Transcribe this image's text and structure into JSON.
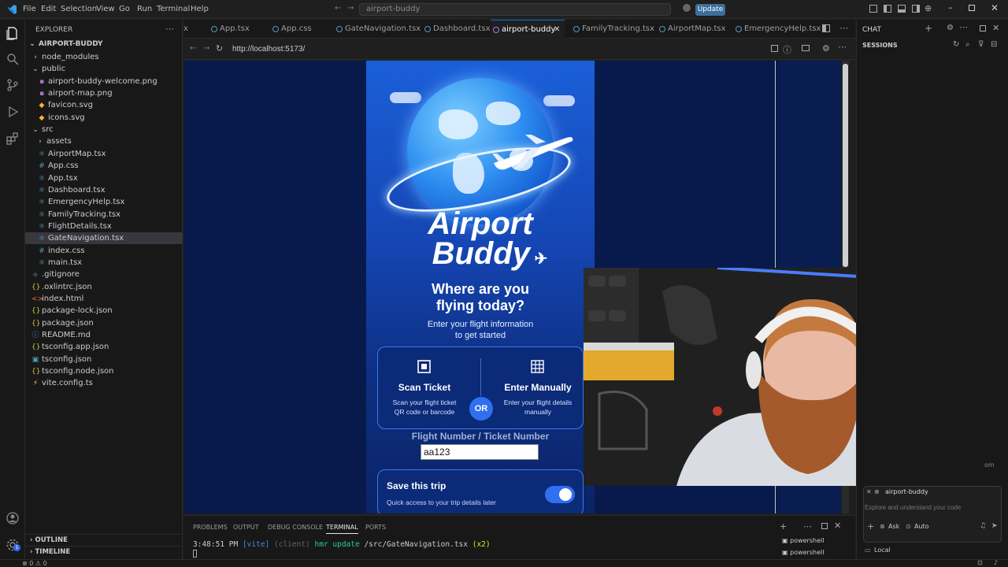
{
  "titlebar": {
    "menus": [
      "File",
      "Edit",
      "Selection",
      "View",
      "Go",
      "Run",
      "Terminal",
      "Help"
    ],
    "search_text": "airport-buddy",
    "update_label": "Update"
  },
  "explorer": {
    "header": "EXPLORER",
    "project": "AIRPORT-BUDDY",
    "items": [
      {
        "label": "node_modules",
        "kind": "folder-closed"
      },
      {
        "label": "public",
        "kind": "folder-open"
      },
      {
        "label": "airport-buddy-welcome.png",
        "kind": "image"
      },
      {
        "label": "airport-map.png",
        "kind": "image"
      },
      {
        "label": "favicon.svg",
        "kind": "svg"
      },
      {
        "label": "icons.svg",
        "kind": "svg"
      },
      {
        "label": "src",
        "kind": "folder-open"
      },
      {
        "label": "assets",
        "kind": "folder-closed"
      },
      {
        "label": "AirportMap.tsx",
        "kind": "tsx"
      },
      {
        "label": "App.css",
        "kind": "css"
      },
      {
        "label": "App.tsx",
        "kind": "tsx"
      },
      {
        "label": "Dashboard.tsx",
        "kind": "tsx"
      },
      {
        "label": "EmergencyHelp.tsx",
        "kind": "tsx"
      },
      {
        "label": "FamilyTracking.tsx",
        "kind": "tsx"
      },
      {
        "label": "FlightDetails.tsx",
        "kind": "tsx"
      },
      {
        "label": "GateNavigation.tsx",
        "kind": "tsx"
      },
      {
        "label": "index.css",
        "kind": "css"
      },
      {
        "label": "main.tsx",
        "kind": "tsx"
      },
      {
        "label": ".gitignore",
        "kind": "git"
      },
      {
        "label": ".oxlintrc.json",
        "kind": "json"
      },
      {
        "label": "index.html",
        "kind": "html"
      },
      {
        "label": "package-lock.json",
        "kind": "json"
      },
      {
        "label": "package.json",
        "kind": "json"
      },
      {
        "label": "README.md",
        "kind": "info"
      },
      {
        "label": "tsconfig.app.json",
        "kind": "json"
      },
      {
        "label": "tsconfig.json",
        "kind": "tsconfig"
      },
      {
        "label": "tsconfig.node.json",
        "kind": "json"
      },
      {
        "label": "vite.config.ts",
        "kind": "vite"
      }
    ],
    "selected": "GateNavigation.tsx",
    "outline_label": "OUTLINE",
    "timeline_label": "TIMELINE"
  },
  "tabs": [
    {
      "label": "x"
    },
    {
      "label": "App.tsx"
    },
    {
      "label": "App.css"
    },
    {
      "label": "GateNavigation.tsx"
    },
    {
      "label": "Dashboard.tsx"
    },
    {
      "label": "airport-buddy",
      "active": true
    },
    {
      "label": "FamilyTracking.tsx"
    },
    {
      "label": "AirportMap.tsx"
    },
    {
      "label": "EmergencyHelp.tsx"
    }
  ],
  "browser": {
    "url": "http://localhost:5173/"
  },
  "app": {
    "title_line1": "Airport",
    "title_line2": "Buddy",
    "headline_line1": "Where are you",
    "headline_line2": "flying today?",
    "sub_line1": "Enter your flight information",
    "sub_line2": "to get started",
    "scan": {
      "title": "Scan Ticket",
      "desc_line1": "Scan your flight ticket",
      "desc_line2": "QR code or barcode"
    },
    "manual": {
      "title": "Enter Manually",
      "desc_line1": "Enter your flight details",
      "desc_line2": "manually"
    },
    "or_label": "OR",
    "flight_label": "Flight Number / Ticket Number",
    "flight_value": "aa123",
    "save_title": "Save this trip",
    "save_desc": "Quick access to your trip details later",
    "save_enabled": true
  },
  "chat": {
    "title": "CHAT",
    "sessions": "SESSIONS",
    "context_chip": "airport-buddy",
    "placeholder": "Explore and understand your code",
    "mode_ask": "Ask",
    "mode_auto": "Auto",
    "location": "Local",
    "partial_text": "om"
  },
  "panel": {
    "tabs": [
      "PROBLEMS",
      "OUTPUT",
      "DEBUG CONSOLE",
      "TERMINAL",
      "PORTS"
    ],
    "active_tab": "TERMINAL",
    "time": "3:48:51 PM",
    "vite_tag": "[vite]",
    "client_tag": "(client)",
    "message": "hmr update",
    "path": "/src/GateNavigation.tsx",
    "count": "(x2)",
    "shells": [
      "powershell",
      "powershell"
    ]
  },
  "statusbar": {
    "problems": "⊗ 0 ⚠ 0"
  },
  "colors": {
    "accent": "#0078d4",
    "app_blue": "#1b5fd8",
    "toggle_on": "#2f6ff0"
  }
}
